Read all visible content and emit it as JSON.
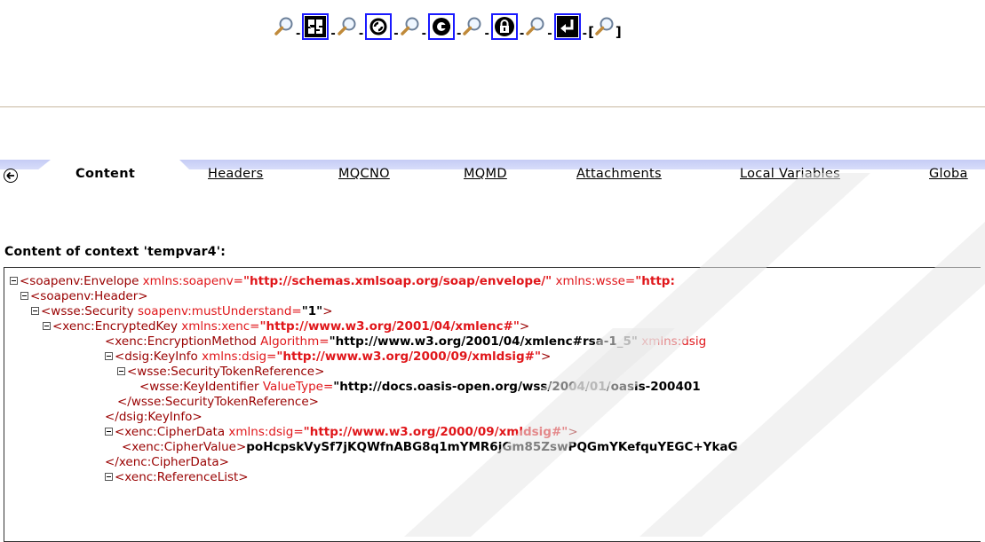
{
  "toolbar": {
    "tools": [
      {
        "icon": "magnify-icon",
        "button_icon": "grid-icon"
      },
      {
        "icon": "magnify-icon",
        "button_icon": "swirl-icon"
      },
      {
        "icon": "magnify-icon",
        "button_icon": "encrypt-icon"
      },
      {
        "icon": "magnify-icon",
        "button_icon": "lock-icon"
      },
      {
        "icon": "magnify-icon",
        "button_icon": "return-icon"
      }
    ],
    "bracket_open": "[",
    "bracket_close": "]"
  },
  "tabs": {
    "back_icon": "back-arrow-icon",
    "content": "Content",
    "headers": "Headers",
    "mqcno": "MQCNO",
    "mqmd": "MQMD",
    "attachments": "Attachments",
    "local_variables": "Local Variables",
    "global": "Globa"
  },
  "heading": "Content of context 'tempvar4':",
  "xml": {
    "l1_open": "<soapenv:Envelope ",
    "l1_attr1": "xmlns:soapenv=",
    "l1_val1": "\"http://schemas.xmlsoap.org/soap/envelope/\"",
    "l1_attr2": " xmlns:wsse=",
    "l1_val2": "\"http:",
    "l2_open": "<soapenv:Header>",
    "l3_open": "<wsse:Security ",
    "l3_attr": "soapenv:mustUnderstand=",
    "l3_val": "\"1\"",
    "l3_close": ">",
    "l4_open": "<xenc:EncryptedKey ",
    "l4_attr": "xmlns:xenc=",
    "l4_val": "\"http://www.w3.org/2001/04/xmlenc#\"",
    "l4_close": ">",
    "l5_open": "<xenc:EncryptionMethod ",
    "l5_attr": "Algorithm=",
    "l5_val": "\"http://www.w3.org/2001/04/xmlenc#rsa-1_5\"",
    "l5_attr2": " xmlns:dsig",
    "l6_open": "<dsig:KeyInfo ",
    "l6_attr": "xmlns:dsig=",
    "l6_val": "\"http://www.w3.org/2000/09/xmldsig#\"",
    "l6_close": ">",
    "l7_open": "<wsse:SecurityTokenReference>",
    "l8_open": "<wsse:KeyIdentifier ",
    "l8_attr": "ValueType=",
    "l8_val": "\"http://docs.oasis-open.org/wss/2004/01/oasis-200401",
    "l9_close": "</wsse:SecurityTokenReference>",
    "l10_close": "</dsig:KeyInfo>",
    "l11_open": "<xenc:CipherData ",
    "l11_attr": "xmlns:dsig=",
    "l11_val": "\"http://www.w3.org/2000/09/xmldsig#\"",
    "l11_close": ">",
    "l12_open": "<xenc:CipherValue>",
    "l12_text": "poHcpskVySf7jKQWfnABG8q1mYMR6jGm85ZswPQGmYKefquYEGC+YkaG",
    "l13_close": "</xenc:CipherData>",
    "l14_open": "<xenc:ReferenceList>"
  }
}
